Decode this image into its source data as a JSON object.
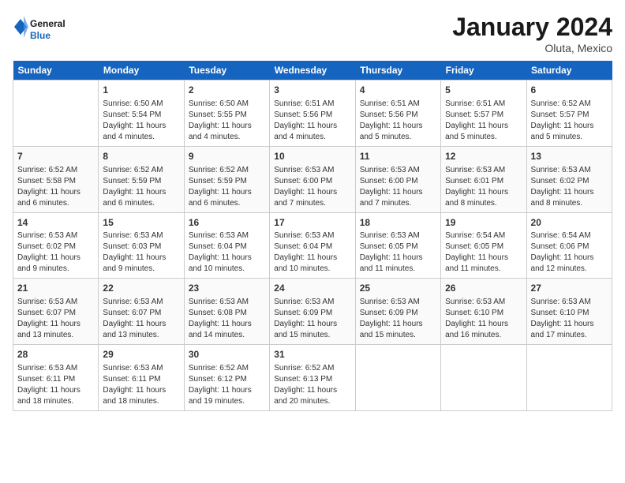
{
  "header": {
    "logo_general": "General",
    "logo_blue": "Blue",
    "month": "January 2024",
    "location": "Oluta, Mexico"
  },
  "days_of_week": [
    "Sunday",
    "Monday",
    "Tuesday",
    "Wednesday",
    "Thursday",
    "Friday",
    "Saturday"
  ],
  "weeks": [
    [
      {
        "day": "",
        "empty": true
      },
      {
        "day": "1",
        "sunrise": "6:50 AM",
        "sunset": "5:54 PM",
        "daylight": "11 hours and 4 minutes."
      },
      {
        "day": "2",
        "sunrise": "6:50 AM",
        "sunset": "5:55 PM",
        "daylight": "11 hours and 4 minutes."
      },
      {
        "day": "3",
        "sunrise": "6:51 AM",
        "sunset": "5:56 PM",
        "daylight": "11 hours and 4 minutes."
      },
      {
        "day": "4",
        "sunrise": "6:51 AM",
        "sunset": "5:56 PM",
        "daylight": "11 hours and 5 minutes."
      },
      {
        "day": "5",
        "sunrise": "6:51 AM",
        "sunset": "5:57 PM",
        "daylight": "11 hours and 5 minutes."
      },
      {
        "day": "6",
        "sunrise": "6:52 AM",
        "sunset": "5:57 PM",
        "daylight": "11 hours and 5 minutes."
      }
    ],
    [
      {
        "day": "7",
        "sunrise": "6:52 AM",
        "sunset": "5:58 PM",
        "daylight": "11 hours and 6 minutes."
      },
      {
        "day": "8",
        "sunrise": "6:52 AM",
        "sunset": "5:59 PM",
        "daylight": "11 hours and 6 minutes."
      },
      {
        "day": "9",
        "sunrise": "6:52 AM",
        "sunset": "5:59 PM",
        "daylight": "11 hours and 6 minutes."
      },
      {
        "day": "10",
        "sunrise": "6:53 AM",
        "sunset": "6:00 PM",
        "daylight": "11 hours and 7 minutes."
      },
      {
        "day": "11",
        "sunrise": "6:53 AM",
        "sunset": "6:00 PM",
        "daylight": "11 hours and 7 minutes."
      },
      {
        "day": "12",
        "sunrise": "6:53 AM",
        "sunset": "6:01 PM",
        "daylight": "11 hours and 8 minutes."
      },
      {
        "day": "13",
        "sunrise": "6:53 AM",
        "sunset": "6:02 PM",
        "daylight": "11 hours and 8 minutes."
      }
    ],
    [
      {
        "day": "14",
        "sunrise": "6:53 AM",
        "sunset": "6:02 PM",
        "daylight": "11 hours and 9 minutes."
      },
      {
        "day": "15",
        "sunrise": "6:53 AM",
        "sunset": "6:03 PM",
        "daylight": "11 hours and 9 minutes."
      },
      {
        "day": "16",
        "sunrise": "6:53 AM",
        "sunset": "6:04 PM",
        "daylight": "11 hours and 10 minutes."
      },
      {
        "day": "17",
        "sunrise": "6:53 AM",
        "sunset": "6:04 PM",
        "daylight": "11 hours and 10 minutes."
      },
      {
        "day": "18",
        "sunrise": "6:53 AM",
        "sunset": "6:05 PM",
        "daylight": "11 hours and 11 minutes."
      },
      {
        "day": "19",
        "sunrise": "6:54 AM",
        "sunset": "6:05 PM",
        "daylight": "11 hours and 11 minutes."
      },
      {
        "day": "20",
        "sunrise": "6:54 AM",
        "sunset": "6:06 PM",
        "daylight": "11 hours and 12 minutes."
      }
    ],
    [
      {
        "day": "21",
        "sunrise": "6:53 AM",
        "sunset": "6:07 PM",
        "daylight": "11 hours and 13 minutes."
      },
      {
        "day": "22",
        "sunrise": "6:53 AM",
        "sunset": "6:07 PM",
        "daylight": "11 hours and 13 minutes."
      },
      {
        "day": "23",
        "sunrise": "6:53 AM",
        "sunset": "6:08 PM",
        "daylight": "11 hours and 14 minutes."
      },
      {
        "day": "24",
        "sunrise": "6:53 AM",
        "sunset": "6:09 PM",
        "daylight": "11 hours and 15 minutes."
      },
      {
        "day": "25",
        "sunrise": "6:53 AM",
        "sunset": "6:09 PM",
        "daylight": "11 hours and 15 minutes."
      },
      {
        "day": "26",
        "sunrise": "6:53 AM",
        "sunset": "6:10 PM",
        "daylight": "11 hours and 16 minutes."
      },
      {
        "day": "27",
        "sunrise": "6:53 AM",
        "sunset": "6:10 PM",
        "daylight": "11 hours and 17 minutes."
      }
    ],
    [
      {
        "day": "28",
        "sunrise": "6:53 AM",
        "sunset": "6:11 PM",
        "daylight": "11 hours and 18 minutes."
      },
      {
        "day": "29",
        "sunrise": "6:53 AM",
        "sunset": "6:11 PM",
        "daylight": "11 hours and 18 minutes."
      },
      {
        "day": "30",
        "sunrise": "6:52 AM",
        "sunset": "6:12 PM",
        "daylight": "11 hours and 19 minutes."
      },
      {
        "day": "31",
        "sunrise": "6:52 AM",
        "sunset": "6:13 PM",
        "daylight": "11 hours and 20 minutes."
      },
      {
        "day": "",
        "empty": true
      },
      {
        "day": "",
        "empty": true
      },
      {
        "day": "",
        "empty": true
      }
    ]
  ],
  "labels": {
    "sunrise_prefix": "Sunrise: ",
    "sunset_prefix": "Sunset: ",
    "daylight_prefix": "Daylight: "
  }
}
